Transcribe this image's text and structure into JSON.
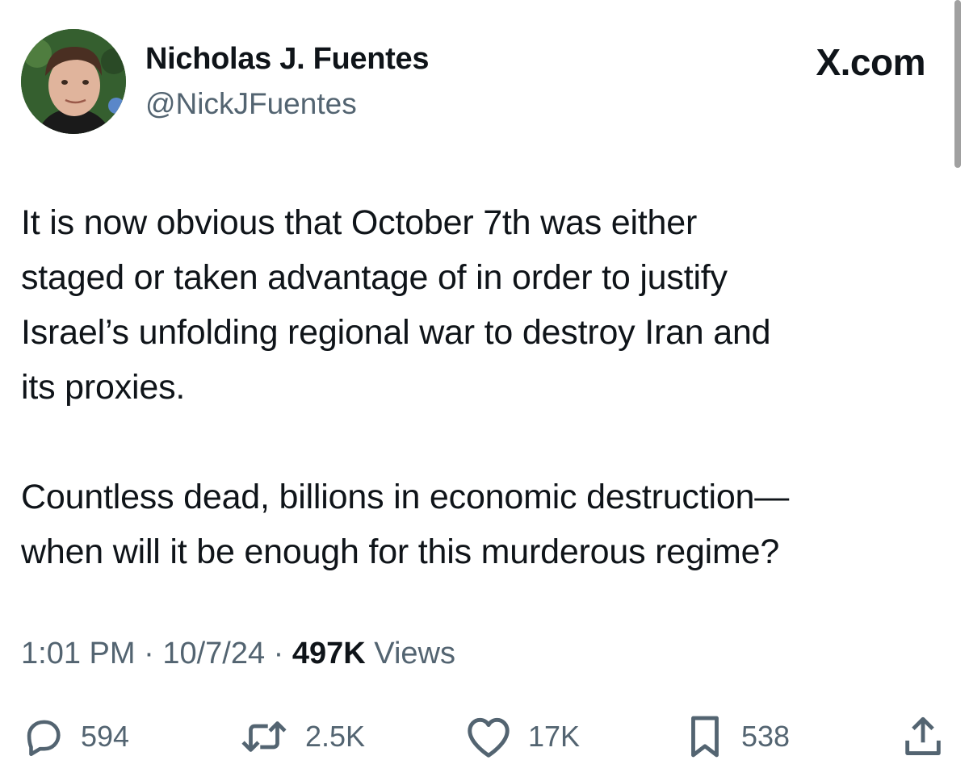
{
  "author": {
    "display_name": "Nicholas J. Fuentes",
    "handle": "@NickJFuentes"
  },
  "site_mark": "X.com",
  "tweet": {
    "paragraphs": [
      [
        "It is now obvious that October 7th was either",
        "staged or taken advantage of in order to justify",
        "Israel’s unfolding regional war to destroy Iran and",
        "its proxies."
      ],
      [
        "Countless dead, billions in economic destruction—",
        "when will it be enough for this murderous regime?"
      ]
    ]
  },
  "meta": {
    "time": "1:01 PM",
    "separator": "·",
    "date": "10/7/24",
    "views_count": "497K",
    "views_label": "Views"
  },
  "actions": {
    "reply": {
      "icon": "reply-bubble-icon",
      "count": "594"
    },
    "repost": {
      "icon": "repost-icon",
      "count": "2.5K"
    },
    "like": {
      "icon": "heart-icon",
      "count": "17K"
    },
    "bookmark": {
      "icon": "bookmark-icon",
      "count": "538"
    },
    "share": {
      "icon": "share-icon"
    }
  },
  "colors": {
    "text_primary": "#0f1419",
    "text_secondary": "#536471",
    "background": "#ffffff"
  }
}
